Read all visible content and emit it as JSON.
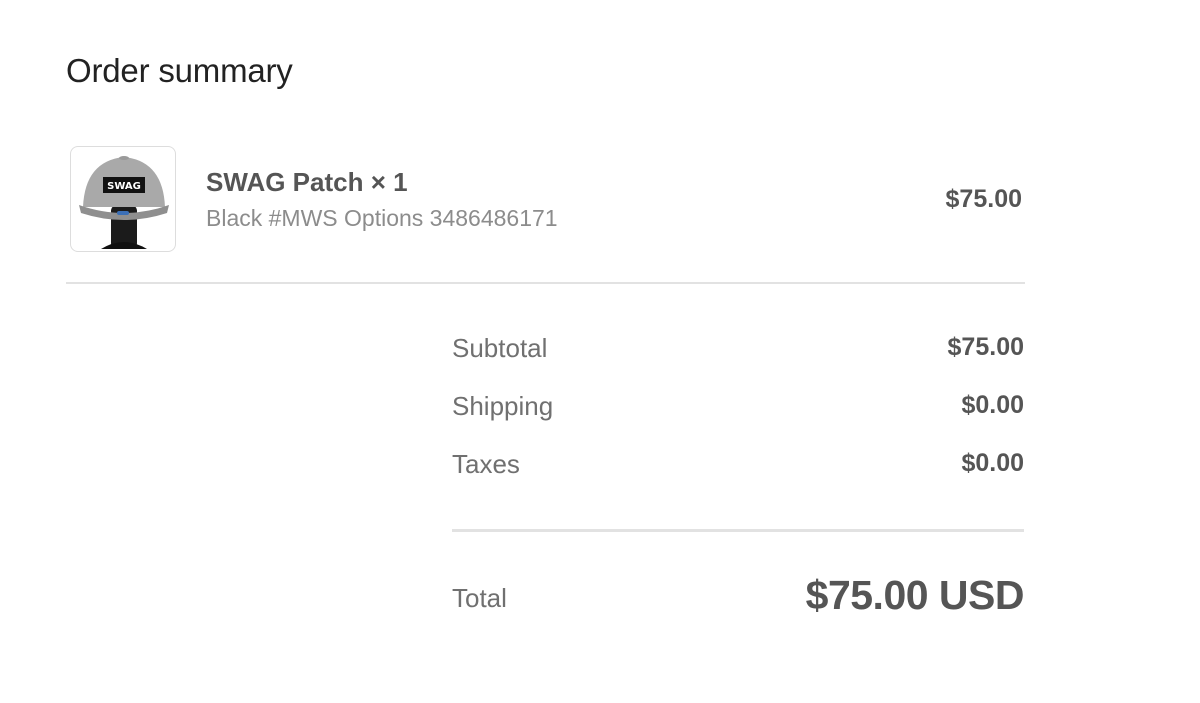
{
  "order_summary": {
    "heading": "Order summary",
    "line_items": [
      {
        "title": "SWAG Patch × 1",
        "variant": "Black #MWS Options 3486486171",
        "price": "$75.00",
        "image_icon": "cap-product-image",
        "image_text": "SWAG"
      }
    ],
    "subtotal": {
      "label": "Subtotal",
      "value": "$75.00"
    },
    "shipping": {
      "label": "Shipping",
      "value": "$0.00"
    },
    "taxes": {
      "label": "Taxes",
      "value": "$0.00"
    },
    "total": {
      "label": "Total",
      "value": "$75.00 USD"
    }
  },
  "colors": {
    "heading_text": "#222222",
    "value_text": "#555555",
    "label_text": "#707070",
    "muted_text": "#8c8c8c",
    "divider": "#e2e2e2"
  }
}
